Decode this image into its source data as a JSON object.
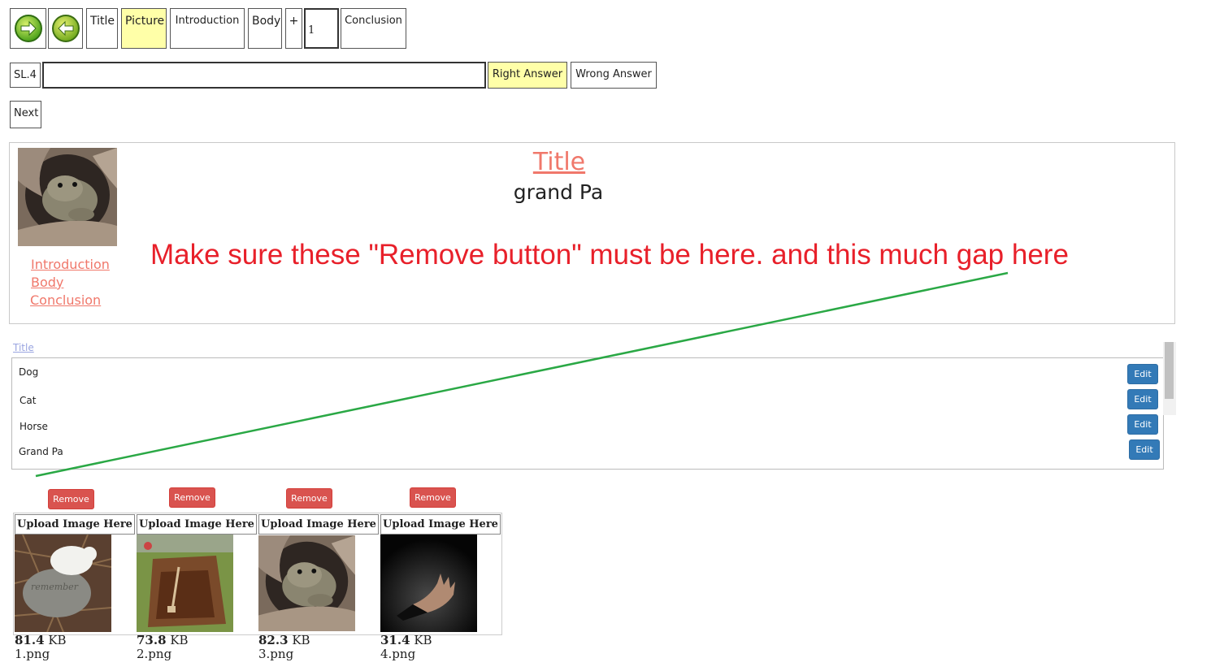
{
  "toolbar": {
    "forward_icon": "arrow-right-circle-icon",
    "back_icon": "arrow-left-circle-icon",
    "title_label": "Title",
    "picture_label": "Picture",
    "introduction_label": "Introduction",
    "body_label": "Body",
    "plus_label": "+",
    "count_value": "1",
    "conclusion_label": "Conclusion"
  },
  "answer_row": {
    "slide_value": "SL.4",
    "answer_value": "",
    "right_answer_label": "Right Answer",
    "wrong_answer_label": "Wrong Answer"
  },
  "next_label": "Next",
  "preview": {
    "title": "Title",
    "subtitle": "grand Pa",
    "links": [
      "Introduction",
      "Body",
      "Conclusion"
    ],
    "annotation": "Make sure these \"Remove button\" must be here. and this much gap here"
  },
  "list": {
    "header_link": "Title",
    "items": [
      {
        "label": "Dog",
        "edit": "Edit"
      },
      {
        "label": "Cat",
        "edit": "Edit"
      },
      {
        "label": "Horse",
        "edit": "Edit"
      },
      {
        "label": "Grand Pa",
        "edit": "Edit"
      }
    ]
  },
  "uploads": [
    {
      "remove": "Remove",
      "upload": "Upload Image Here",
      "size_num": "81.4",
      "size_unit": "KB",
      "name": "1.png"
    },
    {
      "remove": "Remove",
      "upload": "Upload Image Here",
      "size_num": "73.8",
      "size_unit": "KB",
      "name": "2.png"
    },
    {
      "remove": "Remove",
      "upload": "Upload Image Here",
      "size_num": "82.3",
      "size_unit": "KB",
      "name": "3.png"
    },
    {
      "remove": "Remove",
      "upload": "Upload Image Here",
      "size_num": "31.4",
      "size_unit": "KB",
      "name": "4.png"
    }
  ],
  "colors": {
    "highlight": "#ffffa8",
    "link_pink": "#f0786b",
    "annotation_red": "#e8202a",
    "annotation_line": "#2aa845",
    "edit_blue": "#337ab7",
    "remove_red": "#d9534f"
  }
}
